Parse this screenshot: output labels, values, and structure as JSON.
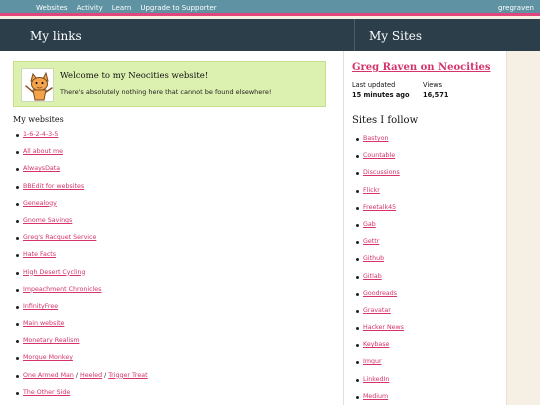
{
  "nav": {
    "links": [
      "Websites",
      "Activity",
      "Learn",
      "Upgrade to Supporter"
    ],
    "user": "gregraven"
  },
  "header": {
    "left_title": "My links",
    "right_title": "My Sites"
  },
  "welcome": {
    "title": "Welcome to my Neocities website!",
    "subtitle": "There's absolutely nothing here that cannot be found elsewhere!",
    "mascot_icon": "neocities-cat-icon"
  },
  "websites": {
    "title": "My websites",
    "items": [
      [
        "1-6-2-4-3-5"
      ],
      [
        "All about me"
      ],
      [
        "AlwaysData"
      ],
      [
        "BBEdit for websites"
      ],
      [
        "Genealogy"
      ],
      [
        "Gnome Savings"
      ],
      [
        "Greg's Racquet Service"
      ],
      [
        "Hate Facts"
      ],
      [
        "High Desert Cycling"
      ],
      [
        "Impeachment Chronicles"
      ],
      [
        "InfinityFree"
      ],
      [
        "Main website"
      ],
      [
        "Monetary Realism"
      ],
      [
        "Morgue Monkey"
      ],
      [
        "One Armed Man",
        "Heeled",
        "Trigger Treat"
      ],
      [
        "The Other Side"
      ]
    ]
  },
  "profile": {
    "site_title": "Greg Raven on Neocities",
    "last_updated_label": "Last updated",
    "last_updated_value": "15 minutes ago",
    "views_label": "Views",
    "views_value": "16,571"
  },
  "follows": {
    "title": "Sites I follow",
    "items": [
      "Bastyon",
      "Countable",
      "Discussions",
      "Flickr",
      "Freetalk45",
      "Gab",
      "Gettr",
      "Github",
      "Gitlab",
      "Goodreads",
      "Gravatar",
      "Hacker News",
      "Keybase",
      "Imgur",
      "LinkedIn",
      "Medium"
    ]
  },
  "colors": {
    "nav_bg": "#5f93a3",
    "nav_accent": "#e0467b",
    "header_bg": "#2c3e4a",
    "link": "#d6336c",
    "welcome_bg": "#dcf0b0"
  }
}
